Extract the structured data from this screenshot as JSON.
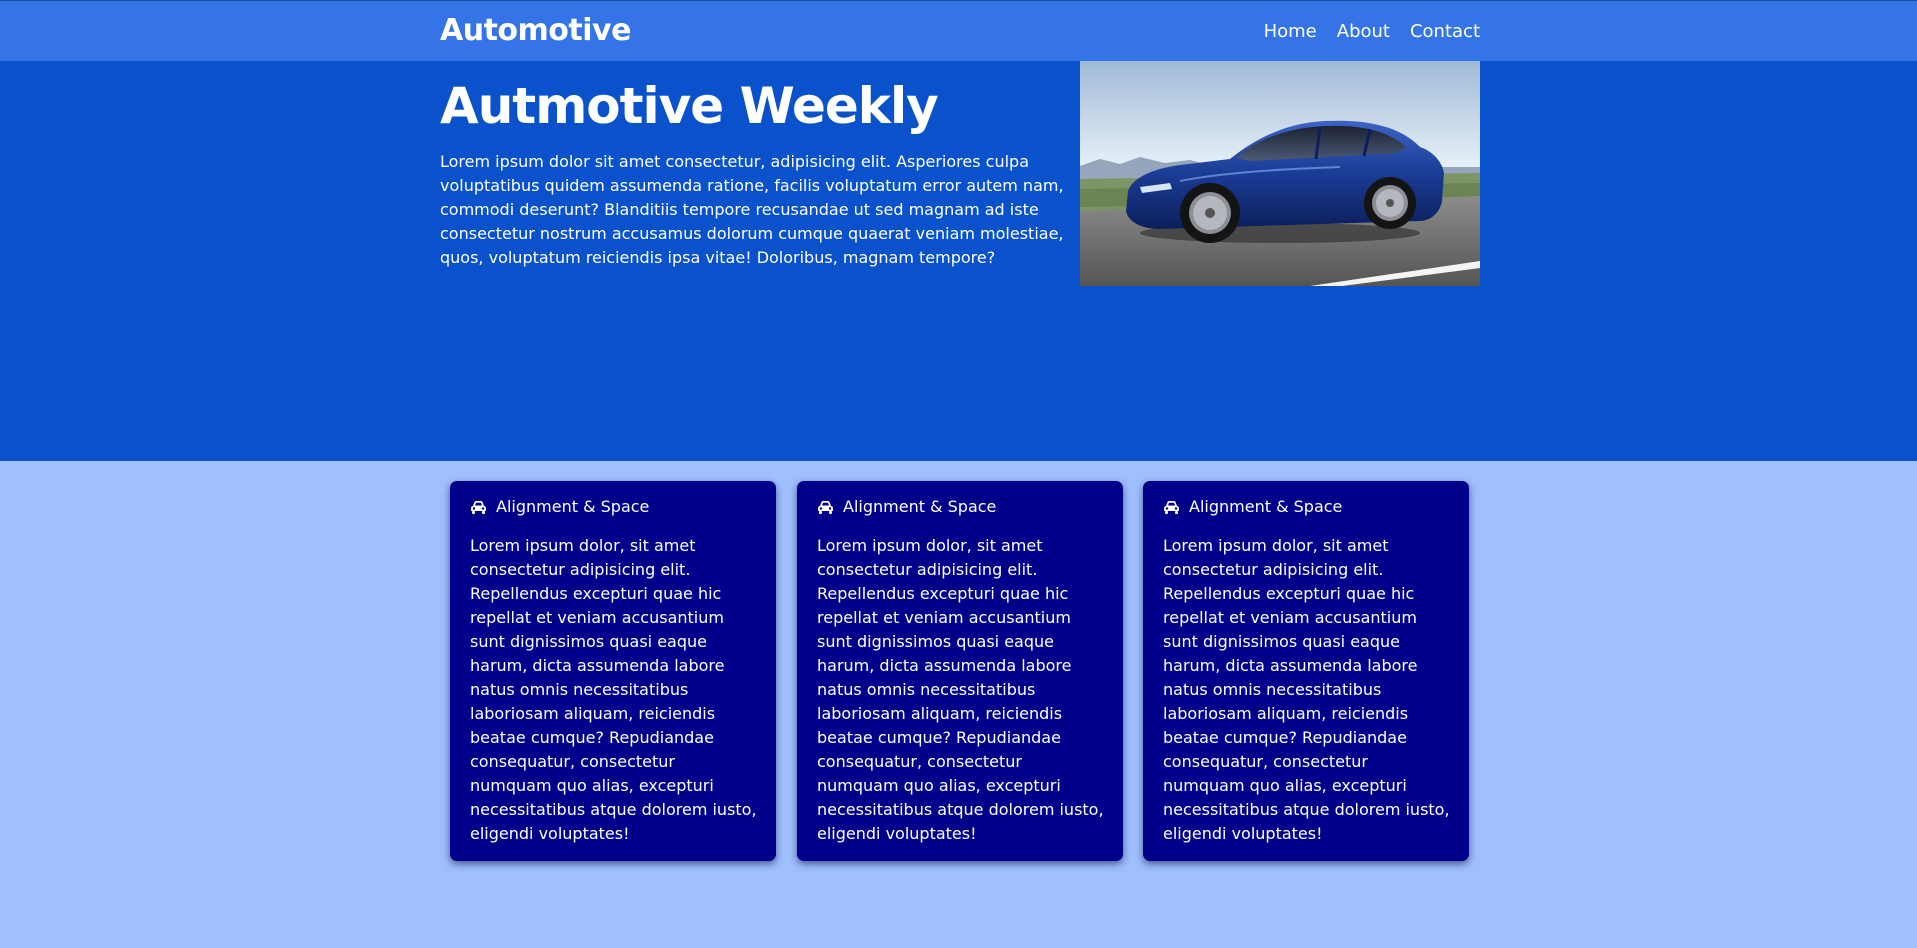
{
  "nav": {
    "brand": "Automotive",
    "links": [
      "Home",
      "About",
      "Contact"
    ]
  },
  "hero": {
    "title": "Autmotive Weekly",
    "text": "Lorem ipsum dolor sit amet consectetur, adipisicing elit. Asperiores culpa voluptatibus quidem assumenda ratione, facilis voluptatum error autem nam, commodi deserunt? Blanditiis tempore recusandae ut sed magnam ad iste consectetur nostrum accusamus dolorum cumque quaerat veniam molestiae, quos, voluptatum reiciendis ipsa vitae! Doloribus, magnam tempore?",
    "image_icon": "car-photo"
  },
  "cards": [
    {
      "icon": "car-icon",
      "title": "Alignment & Space",
      "text": "Lorem ipsum dolor, sit amet consectetur adipisicing elit. Repellendus excepturi quae hic repellat et veniam accusantium sunt dignissimos quasi eaque harum, dicta assumenda labore natus omnis necessitatibus laboriosam aliquam, reiciendis beatae cumque? Repudiandae consequatur, consectetur numquam quo alias, excepturi necessitatibus atque dolorem iusto, eligendi voluptates!"
    },
    {
      "icon": "car-icon",
      "title": "Alignment & Space",
      "text": "Lorem ipsum dolor, sit amet consectetur adipisicing elit. Repellendus excepturi quae hic repellat et veniam accusantium sunt dignissimos quasi eaque harum, dicta assumenda labore natus omnis necessitatibus laboriosam aliquam, reiciendis beatae cumque? Repudiandae consequatur, consectetur numquam quo alias, excepturi necessitatibus atque dolorem iusto, eligendi voluptates!"
    },
    {
      "icon": "car-icon",
      "title": "Alignment & Space",
      "text": "Lorem ipsum dolor, sit amet consectetur adipisicing elit. Repellendus excepturi quae hic repellat et veniam accusantium sunt dignissimos quasi eaque harum, dicta assumenda labore natus omnis necessitatibus laboriosam aliquam, reiciendis beatae cumque? Repudiandae consequatur, consectetur numquam quo alias, excepturi necessitatibus atque dolorem iusto, eligendi voluptates!"
    }
  ],
  "colors": {
    "navbar": "#3574e6",
    "hero": "#0a52cc",
    "page": "#9fbfff",
    "card": "#00008b",
    "text": "#ffffff"
  }
}
